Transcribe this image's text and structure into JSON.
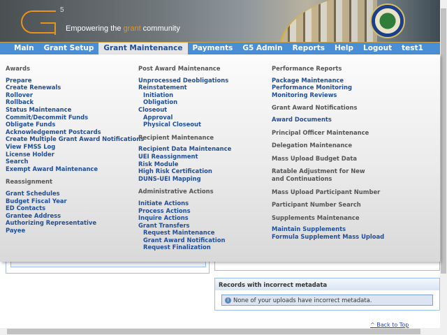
{
  "header": {
    "logo": "G5",
    "tagline_pre": "Empowering the ",
    "tagline_accent": "grant",
    "tagline_post": " community"
  },
  "nav": [
    "Main",
    "Grant Setup",
    "Grant Maintenance",
    "Payments",
    "G5 Admin",
    "Reports",
    "Help",
    "Logout",
    "test1"
  ],
  "nav_active": "Grant Maintenance",
  "menu": [
    [
      {
        "t": "h",
        "v": "Awards"
      },
      {
        "t": "l",
        "v": "Prepare"
      },
      {
        "t": "l",
        "v": "Create Renewals"
      },
      {
        "t": "l",
        "v": "Rollover"
      },
      {
        "t": "l",
        "v": "Rollback"
      },
      {
        "t": "l",
        "v": "Status Maintenance"
      },
      {
        "t": "l",
        "v": "Commit/Decommit Funds"
      },
      {
        "t": "l",
        "v": "Obligate Funds"
      },
      {
        "t": "l",
        "v": "Acknowledgement Postcards"
      },
      {
        "t": "l",
        "v": "Create Multiple Grant Award Notifications"
      },
      {
        "t": "l",
        "v": "View FMSS Log"
      },
      {
        "t": "l",
        "v": "License Holder"
      },
      {
        "t": "l",
        "v": "Search"
      },
      {
        "t": "l",
        "v": "Exempt Award Maintenance"
      },
      {
        "t": "h",
        "v": "Reassignment"
      },
      {
        "t": "l",
        "v": "Grant Schedules"
      },
      {
        "t": "l",
        "v": "Budget Fiscal Year"
      },
      {
        "t": "l",
        "v": "ED Contacts"
      },
      {
        "t": "l",
        "v": "Grantee Address"
      },
      {
        "t": "l",
        "v": "Authorizing Representative"
      },
      {
        "t": "l",
        "v": "Payee"
      }
    ],
    [
      {
        "t": "h",
        "v": "Post Award Maintenance"
      },
      {
        "t": "l",
        "v": "Unprocessed Deobligations"
      },
      {
        "t": "l",
        "v": "Reinstatement"
      },
      {
        "t": "s",
        "v": "Initiation"
      },
      {
        "t": "s",
        "v": "Obligation"
      },
      {
        "t": "l",
        "v": "Closeout"
      },
      {
        "t": "s",
        "v": "Approval"
      },
      {
        "t": "s",
        "v": "Physical Closeout"
      },
      {
        "t": "h",
        "v": "Recipient Maintenance"
      },
      {
        "t": "l",
        "v": "Recipient Data Maintenance"
      },
      {
        "t": "l",
        "v": "UEI Reassignment"
      },
      {
        "t": "l",
        "v": "Risk Module"
      },
      {
        "t": "l",
        "v": "High Risk Certification"
      },
      {
        "t": "l",
        "v": "DUNS-UEI Mapping"
      },
      {
        "t": "h",
        "v": "Administrative Actions"
      },
      {
        "t": "l",
        "v": "Initiate Actions"
      },
      {
        "t": "l",
        "v": "Process Actions"
      },
      {
        "t": "l",
        "v": "Inquire Actions"
      },
      {
        "t": "l",
        "v": "Grant Transfers"
      },
      {
        "t": "s",
        "v": "Request Maintenance"
      },
      {
        "t": "s",
        "v": "Grant Award Notification"
      },
      {
        "t": "s",
        "v": "Request Finalization"
      }
    ],
    [
      {
        "t": "h",
        "v": "Performance Reports"
      },
      {
        "t": "l",
        "v": "Package Maintenance"
      },
      {
        "t": "l",
        "v": "Performance Monitoring"
      },
      {
        "t": "l",
        "v": "Monitoring Reviews"
      },
      {
        "t": "h",
        "v": "Grant Award Notifications"
      },
      {
        "t": "l",
        "v": "Award Documents"
      },
      {
        "t": "h",
        "v": "Principal Officer Maintenance"
      },
      {
        "t": "h",
        "v": "Delegation Maintenance"
      },
      {
        "t": "h",
        "v": "Mass Upload Budget Data"
      },
      {
        "t": "h",
        "v": "Ratable Adjustment for New and Continuations"
      },
      {
        "t": "h",
        "v": "Mass Upload Participant Number"
      },
      {
        "t": "h",
        "v": "Participant Number Search"
      },
      {
        "t": "h",
        "v": "Supplements Maintenance"
      },
      {
        "t": "l",
        "v": "Maintain Supplements"
      },
      {
        "t": "l",
        "v": "Formula Supplement Mass Upload"
      }
    ]
  ],
  "metadata_panel": {
    "title": "Records with incorrect metadata",
    "message": "None of your uploads have incorrect metadata.",
    "icon": "info-icon"
  },
  "back_to_top": "^ Back to Top",
  "colors": {
    "nav": "#4a8fd6",
    "link": "#1f4e9a",
    "accent": "#e8941c"
  }
}
